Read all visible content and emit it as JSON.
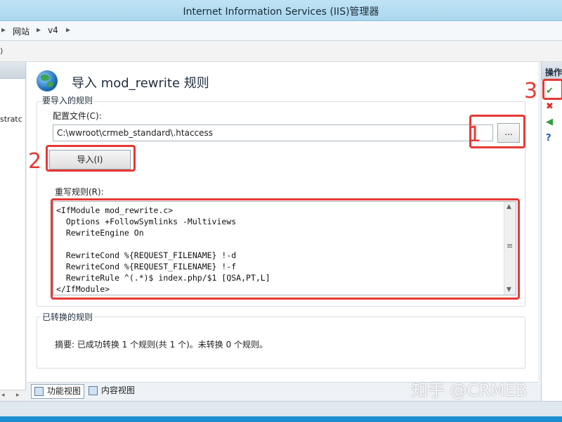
{
  "window": {
    "title": "Internet Information Services (IIS)管理器"
  },
  "breadcrumb": {
    "items": [
      "网站",
      "v4"
    ]
  },
  "menubar": {
    "fragment": ")"
  },
  "left_pane": {
    "node_fragment": "stratc"
  },
  "page": {
    "title": "导入 mod_rewrite 规则"
  },
  "import_group": {
    "label": "要导入的规则",
    "config_label": "配置文件(C):",
    "config_value": "C:\\wwroot\\crmeb_standard\\.htaccess",
    "browse_label": "...",
    "import_button": "导入(I)",
    "rules_label": "重写规则(R):",
    "rules_text": "<IfModule mod_rewrite.c>\n  Options +FollowSymlinks -Multiviews\n  RewriteEngine On\n\n  RewriteCond %{REQUEST_FILENAME} !-d\n  RewriteCond %{REQUEST_FILENAME} !-f\n  RewriteRule ^(.*)$ index.php/$1 [QSA,PT,L]\n</IfModule>"
  },
  "converted_group": {
    "label": "已转换的规则",
    "summary": "摘要: 已成功转换 1 个规则(共 1 个)。未转换 0 个规则。"
  },
  "bottom_tabs": [
    "功能视图",
    "内容视图"
  ],
  "actions_pane": {
    "title": "操作"
  },
  "annotations": {
    "marker_1": "1",
    "marker_2": "2",
    "marker_3": "3"
  },
  "watermark": "知乎 @CRMEB",
  "colors": {
    "highlight": "#e53935",
    "accent_blue": "#1d8fd0",
    "title_bar": "#bfe3f4"
  },
  "icons": [
    "globe-icon",
    "apply-check-icon",
    "cancel-x-icon",
    "back-arrow-icon",
    "help-icon",
    "features-view-icon",
    "content-view-icon"
  ]
}
